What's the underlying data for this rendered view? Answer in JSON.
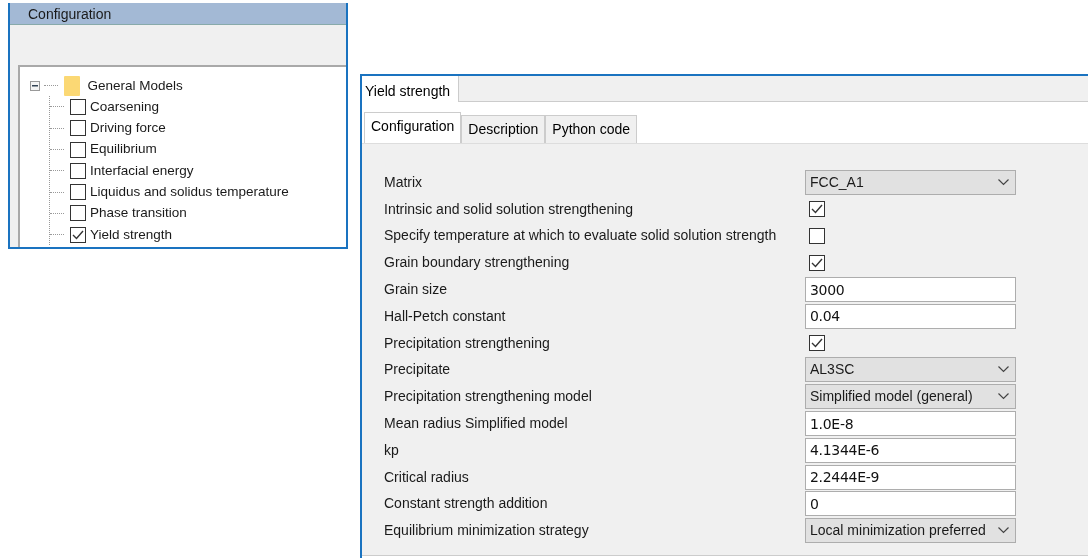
{
  "left_panel": {
    "title": "Configuration",
    "tree": {
      "label": "General Models",
      "expanded": true,
      "children": [
        {
          "label": "Coarsening",
          "checked": false
        },
        {
          "label": "Driving force",
          "checked": false
        },
        {
          "label": "Equilibrium",
          "checked": false
        },
        {
          "label": "Interfacial energy",
          "checked": false
        },
        {
          "label": "Liquidus and solidus temperature",
          "checked": false
        },
        {
          "label": "Phase transition",
          "checked": false
        },
        {
          "label": "Yield strength",
          "checked": true
        }
      ]
    }
  },
  "right_panel": {
    "document_tabs": [
      {
        "label": "Yield strength",
        "selected": true
      }
    ],
    "tabs": [
      {
        "label": "Configuration",
        "selected": true
      },
      {
        "label": "Description",
        "selected": false
      },
      {
        "label": "Python code",
        "selected": false
      }
    ],
    "fields": [
      {
        "kind": "select",
        "label": "Matrix",
        "value": "FCC_A1"
      },
      {
        "kind": "checkbox",
        "label": "Intrinsic and solid solution strengthening",
        "checked": true
      },
      {
        "kind": "checkbox",
        "label": "Specify temperature at which to evaluate solid solution strength",
        "checked": false
      },
      {
        "kind": "checkbox",
        "label": "Grain boundary strengthening",
        "checked": true
      },
      {
        "kind": "text",
        "label": "Grain size",
        "value": "3000"
      },
      {
        "kind": "text",
        "label": "Hall-Petch constant",
        "value": "0.04"
      },
      {
        "kind": "checkbox",
        "label": "Precipitation strengthening",
        "checked": true
      },
      {
        "kind": "select",
        "label": "Precipitate",
        "value": "AL3SC"
      },
      {
        "kind": "select",
        "label": "Precipitation strengthening model",
        "value": "Simplified model (general)"
      },
      {
        "kind": "text",
        "label": "Mean radius Simplified model",
        "value": "1.0E-8"
      },
      {
        "kind": "text",
        "label": "kp",
        "value": "4.1344E-6"
      },
      {
        "kind": "text",
        "label": "Critical radius",
        "value": "2.2444E-9"
      },
      {
        "kind": "text",
        "label": "Constant strength addition",
        "value": "0"
      },
      {
        "kind": "select",
        "label": "Equilibrium minimization strategy",
        "value": "Local minimization preferred"
      }
    ]
  }
}
